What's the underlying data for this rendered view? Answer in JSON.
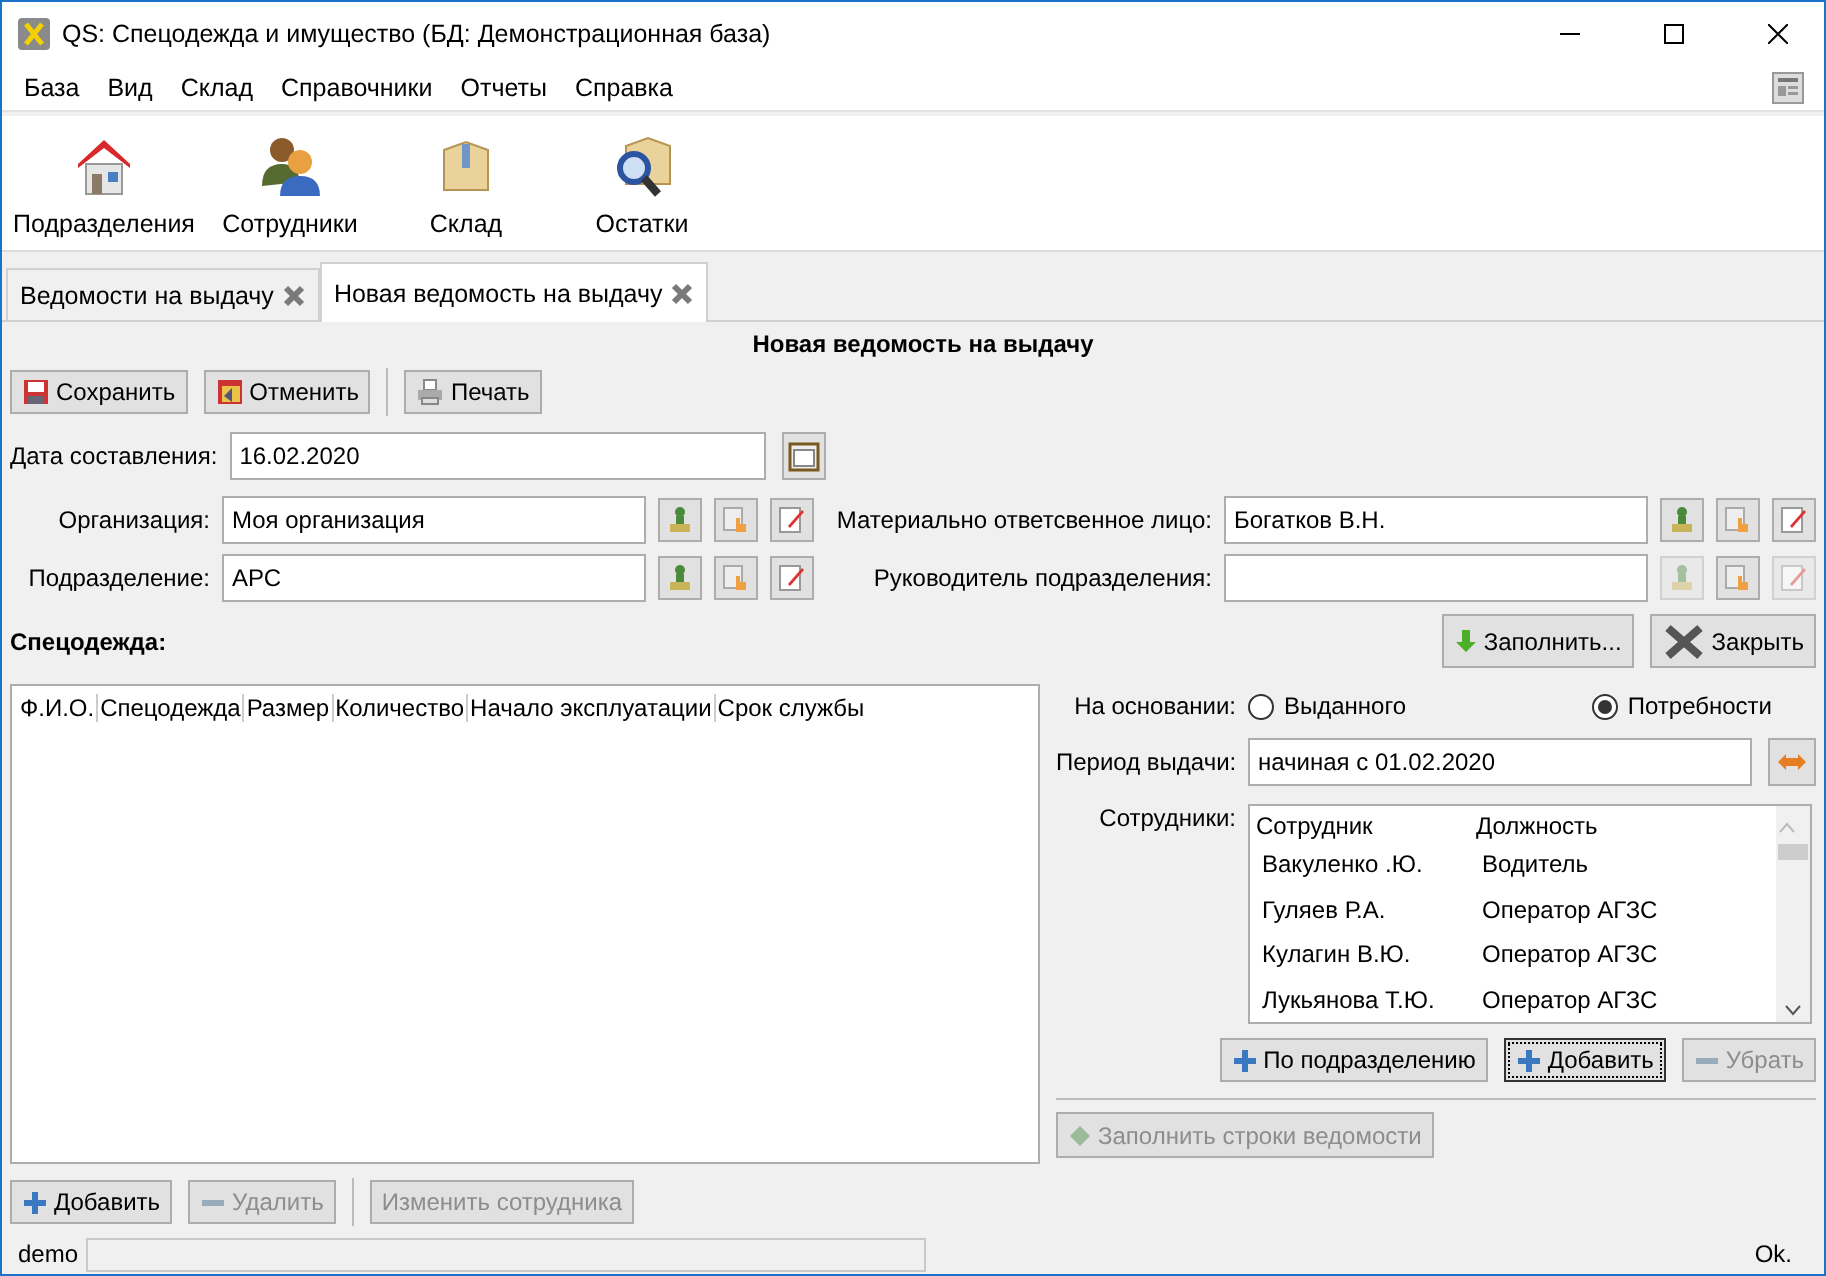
{
  "window": {
    "title": "QS: Спецодежда и имущество (БД: Демонстрационная база)"
  },
  "menu": [
    "База",
    "Вид",
    "Склад",
    "Справочники",
    "Отчеты",
    "Справка"
  ],
  "toolbar": [
    {
      "kind": "house",
      "label": "Подразделения"
    },
    {
      "kind": "people",
      "label": "Сотрудники"
    },
    {
      "kind": "box",
      "label": "Склад"
    },
    {
      "kind": "search-box",
      "label": "Остатки"
    }
  ],
  "tabs": [
    {
      "label": "Ведомости на выдачу",
      "selected": false
    },
    {
      "label": "Новая ведомость на выдачу",
      "selected": true
    }
  ],
  "document_title": "Новая ведомость на выдачу",
  "actions": [
    {
      "kind": "save",
      "label": "Сохранить"
    },
    {
      "kind": "cancel",
      "label": "Отменить"
    },
    {
      "kind": "print",
      "label": "Печать"
    }
  ],
  "date": {
    "label": "Дата составления:",
    "value": "16.02.2020"
  },
  "fields": [
    {
      "label": "Организация:",
      "value": "Моя организация",
      "actions": [
        {
          "kind": "stamp",
          "disabled": false
        },
        {
          "kind": "choose",
          "disabled": false
        },
        {
          "kind": "edit",
          "disabled": false
        }
      ]
    },
    {
      "label": "Материально ответсвенное лицо:",
      "value": "Богатков В.Н.",
      "actions": [
        {
          "kind": "stamp",
          "disabled": false
        },
        {
          "kind": "choose",
          "disabled": false
        },
        {
          "kind": "edit",
          "disabled": false
        }
      ]
    },
    {
      "label": "Подразделение:",
      "value": "АРС",
      "actions": [
        {
          "kind": "stamp",
          "disabled": false
        },
        {
          "kind": "choose",
          "disabled": false
        },
        {
          "kind": "edit",
          "disabled": false
        }
      ]
    },
    {
      "label": "Руководитель подразделения:",
      "actions": [
        {
          "kind": "stamp",
          "disabled": true
        },
        {
          "kind": "choose",
          "disabled": false
        },
        {
          "kind": "edit",
          "disabled": true
        }
      ]
    }
  ],
  "clothing": {
    "label": "Спецодежда:",
    "fill_button": "Заполнить...",
    "close_button": "Закрыть",
    "columns": [
      "Ф.И.О.",
      "Спецодежда",
      "Размер",
      "Количество",
      "Начало эксплуатации",
      "Срок службы"
    ]
  },
  "basis": {
    "label": "На основании:",
    "options": [
      {
        "label": "Выданного",
        "selected": false
      },
      {
        "label": "Потребности",
        "selected": true
      }
    ]
  },
  "period": {
    "label": "Период выдачи:",
    "value": "начиная с 01.02.2020"
  },
  "employees": {
    "label": "Сотрудники:",
    "columns": [
      "Сотрудник",
      "Должность"
    ],
    "rows": [
      {
        "name": "Вакуленко  .Ю.",
        "position": "Водитель"
      },
      {
        "name": "Гуляев Р.А.",
        "position": "Оператор АГЗС"
      },
      {
        "name": "Кулагин В.Ю.",
        "position": "Оператор АГЗС"
      },
      {
        "name": "Лукьянова Т.Ю.",
        "position": "Оператор АГЗС"
      }
    ],
    "buttons": [
      {
        "kind": "plus",
        "label": "По подразделению",
        "disabled": false,
        "focused": false
      },
      {
        "kind": "plus",
        "label": "Добавить",
        "disabled": false,
        "focused": true
      },
      {
        "kind": "minus",
        "label": "Убрать",
        "disabled": true,
        "focused": false
      }
    ]
  },
  "fill_rows": {
    "label": "Заполнить строки ведомости",
    "disabled": true
  },
  "bottom_buttons": [
    {
      "kind": "plus",
      "label": "Добавить",
      "disabled": false
    },
    {
      "kind": "minus",
      "label": "Удалить",
      "disabled": true
    },
    {
      "kind": "none",
      "label": "Изменить сотрудника",
      "disabled": true
    }
  ],
  "status_bar": {
    "user": "demo",
    "message": "Ok."
  }
}
